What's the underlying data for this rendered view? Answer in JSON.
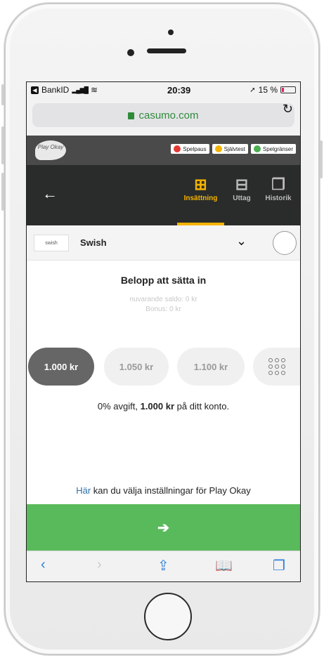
{
  "status_bar": {
    "carrier": "BankID",
    "time": "20:39",
    "battery": "15 %"
  },
  "browser": {
    "url": "casumo.com"
  },
  "playokay": {
    "logo_text": "Play Okay",
    "chips": [
      {
        "label": "Spelpaus",
        "color": "#e53935"
      },
      {
        "label": "Självtest",
        "color": "#f5b300"
      },
      {
        "label": "Spelgränser",
        "color": "#4caf50"
      }
    ]
  },
  "nav": {
    "tabs": [
      {
        "label": "Insättning",
        "icon": "deposit-icon",
        "active": true
      },
      {
        "label": "Uttag",
        "icon": "withdraw-icon",
        "active": false
      },
      {
        "label": "Historik",
        "icon": "history-icon",
        "active": false
      }
    ]
  },
  "payment": {
    "logo_text": "swish",
    "method": "Swish"
  },
  "amount": {
    "title": "Belopp att sätta in",
    "current_balance": "nuvarande saldo: 0 kr",
    "bonus": "Bonus: 0 kr",
    "options": [
      "1.000 kr",
      "1.050 kr",
      "1.100 kr"
    ],
    "selected_index": 0,
    "fee_prefix": "0% avgift, ",
    "fee_amount": "1.000 kr",
    "fee_suffix": " på ditt konto."
  },
  "settings": {
    "link": "Här",
    "text": " kan du välja inställningar för Play Okay"
  },
  "submit": {
    "icon": "arrow-right-icon"
  },
  "colors": {
    "accent": "#f5b300",
    "submit": "#59ba5b",
    "selected_amount": "#666666"
  }
}
